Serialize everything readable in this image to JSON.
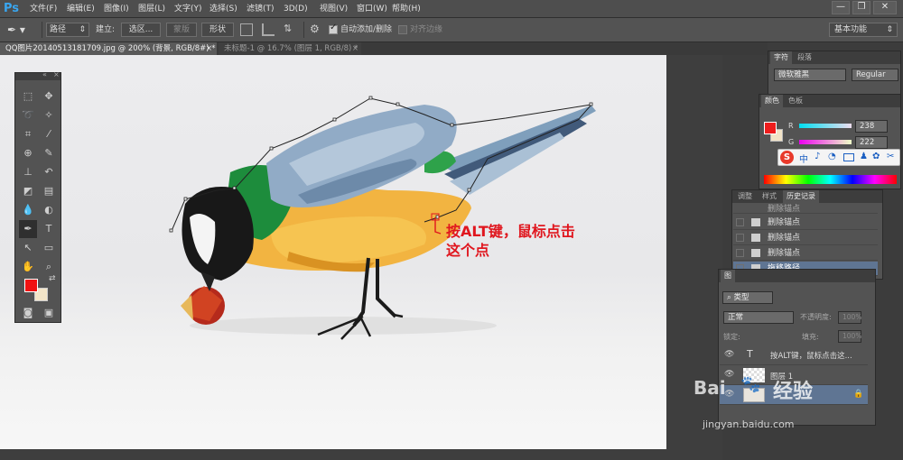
{
  "app": {
    "logo": "Ps"
  },
  "menu": [
    "文件(F)",
    "编辑(E)",
    "图像(I)",
    "图层(L)",
    "文字(Y)",
    "选择(S)",
    "滤镜(T)",
    "3D(D)",
    "视图(V)",
    "窗口(W)",
    "帮助(H)"
  ],
  "window_controls": {
    "min": "—",
    "max": "❐",
    "close": "✕"
  },
  "options_bar": {
    "mode": "路径",
    "create_label": "建立:",
    "selection_btn": "选区...",
    "mask_btn": "蒙版",
    "shape_btn": "形状",
    "auto_add_label": "自动添加/删除",
    "align_edges_label": "对齐边缘",
    "workspace": "基本功能"
  },
  "tabs": [
    {
      "label": "QQ图片20140513181709.jpg @ 200% (背景, RGB/8#) *",
      "close": "×"
    },
    {
      "label": "未标题-1 @ 16.7% (图层 1, RGB/8) *",
      "close": "×"
    }
  ],
  "canvas": {
    "annotation_line1": "按ALT键，鼠标点击",
    "annotation_line2": "这个点"
  },
  "character_panel": {
    "tabs": [
      "字符",
      "段落"
    ],
    "font_family": "微软雅黑",
    "font_style": "Regular"
  },
  "color_panel": {
    "tabs": [
      "颜色",
      "色板"
    ],
    "r_label": "R",
    "r_value": "238",
    "g_label": "G",
    "g_value": "222",
    "foreground": "#ee1d1d",
    "background": "#f2e4c8"
  },
  "ime_bar": {
    "logo": "S",
    "lang": "中"
  },
  "history_panel": {
    "tabs": [
      "调整",
      "样式",
      "历史记录"
    ],
    "items": [
      "删除锚点",
      "删除锚点",
      "删除锚点",
      "删除锚点",
      "拖移路径"
    ]
  },
  "layers_panel": {
    "tab": "图",
    "filter": "类型",
    "blend_mode": "正常",
    "opacity_label": "不透明度:",
    "opacity_value": "100%",
    "lock_label": "锁定:",
    "fill_label": "填充:",
    "fill_value": "100%",
    "layers": [
      {
        "type_glyph": "T",
        "name": "按ALT键，鼠标点击这..."
      },
      {
        "name": "图层 1"
      },
      {
        "name": ""
      }
    ]
  },
  "watermark": {
    "brand_en": "Bai",
    "brand_cn": "经验",
    "url": "jingyan.baidu.com"
  },
  "colors": {
    "annotation": "#e0161e",
    "ps_blue": "#39a6f0",
    "path": "#1a1a1a"
  }
}
